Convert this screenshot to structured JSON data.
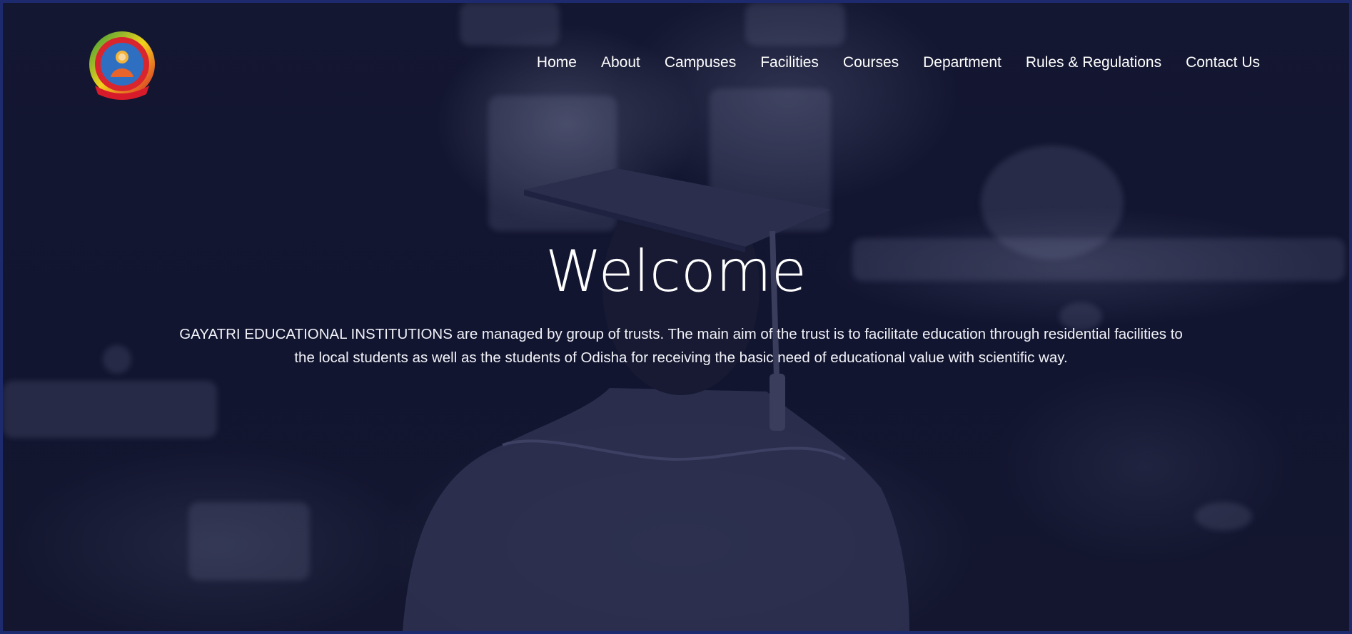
{
  "site": {
    "logo_icon": "gayatri-educational-institutions-logo-icon"
  },
  "nav": {
    "items": [
      {
        "label": "Home"
      },
      {
        "label": "About"
      },
      {
        "label": "Campuses"
      },
      {
        "label": "Facilities"
      },
      {
        "label": "Courses"
      },
      {
        "label": "Department"
      },
      {
        "label": "Rules & Regulations"
      },
      {
        "label": "Contact Us"
      }
    ]
  },
  "hero": {
    "title": "Welcome",
    "description": "GAYATRI EDUCATIONAL INSTITUTIONS are managed by group of trusts. The main aim of the trust is to facilitate education through residential facilities to the local students as well as the students of Odisha for receiving the basic need of educational value with scientific way.",
    "background_image": "graduate-in-cap-and-gown-photo"
  },
  "colors": {
    "overlay": "#141731",
    "border": "#1e2a6e",
    "text": "#ffffff"
  }
}
